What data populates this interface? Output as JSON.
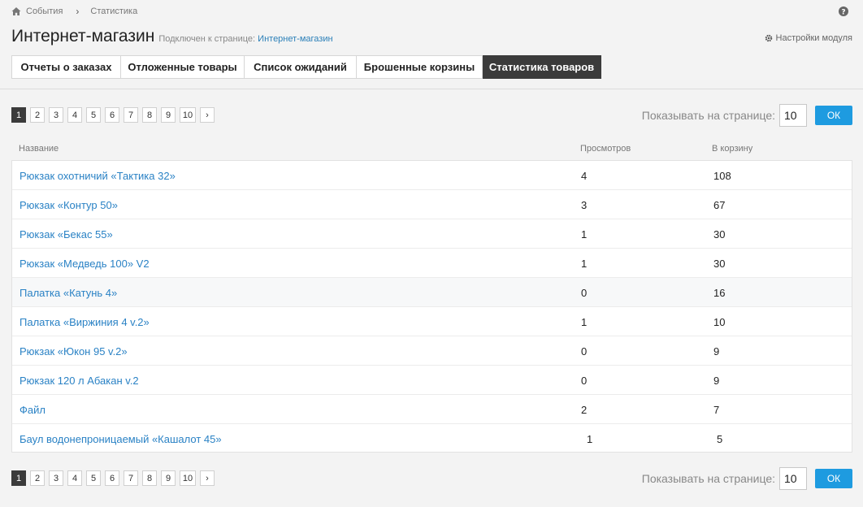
{
  "breadcrumb": {
    "items": [
      "События",
      "Статистика"
    ]
  },
  "header": {
    "title": "Интернет-магазин",
    "subtitle_prefix": "Подключен к странице:",
    "subtitle_link": "Интернет-магазин",
    "settings_label": "Настройки модуля"
  },
  "tabs": [
    {
      "label": "Отчеты о заказах"
    },
    {
      "label": "Отложенные товары"
    },
    {
      "label": "Список ожиданий"
    },
    {
      "label": "Брошенные корзины"
    },
    {
      "label": "Статистика товаров",
      "active": true
    }
  ],
  "pagination": {
    "pages": [
      "1",
      "2",
      "3",
      "4",
      "5",
      "6",
      "7",
      "8",
      "9",
      "10"
    ],
    "current": "1",
    "next": "›",
    "per_page_label": "Показывать на странице:",
    "per_page_value": "10",
    "ok_label": "ОК"
  },
  "table": {
    "columns": [
      "Название",
      "Просмотров",
      "В корзину"
    ],
    "rows": [
      {
        "name": "Рюкзак охотничий «Тактика 32»",
        "views": "4",
        "cart": "108"
      },
      {
        "name": "Рюкзак «Контур 50»",
        "views": "3",
        "cart": "67"
      },
      {
        "name": "Рюкзак «Бекас 55»",
        "views": "1",
        "cart": "30"
      },
      {
        "name": "Рюкзак «Медведь 100» V2",
        "views": "1",
        "cart": "30"
      },
      {
        "name": "Палатка «Катунь 4»",
        "views": "0",
        "cart": "16"
      },
      {
        "name": "Палатка «Виржиния 4 v.2»",
        "views": "1",
        "cart": "10"
      },
      {
        "name": "Рюкзак «Юкон 95 v.2»",
        "views": "0",
        "cart": "9"
      },
      {
        "name": "Рюкзак 120 л Абакан v.2",
        "views": "0",
        "cart": "9"
      },
      {
        "name": "Файл",
        "views": "2",
        "cart": "7"
      },
      {
        "name": "Баул водонепроницаемый «Кашалот 45»",
        "views": "1",
        "cart": "5"
      }
    ]
  },
  "colors": {
    "accent": "#1e9be0",
    "link": "#2a82c5",
    "active_tab": "#3b3b3b"
  }
}
